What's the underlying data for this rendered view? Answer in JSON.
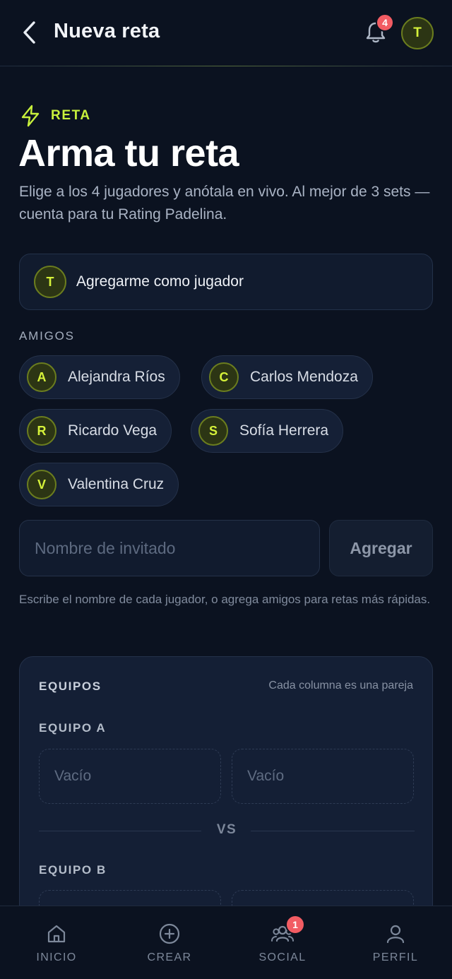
{
  "header": {
    "title": "Nueva reta",
    "notifications_count": "4",
    "avatar_initial": "T"
  },
  "hero": {
    "eyebrow": "RETA",
    "title": "Arma tu reta",
    "description": "Elige a los 4 jugadores y anótala en vivo. Al mejor de 3 sets — cuenta para tu Rating Padelina."
  },
  "add_me": {
    "avatar_initial": "T",
    "label": "Agregarme como jugador"
  },
  "friends": {
    "label": "AMIGOS",
    "items": [
      {
        "initial": "A",
        "name": "Alejandra Ríos"
      },
      {
        "initial": "C",
        "name": "Carlos Mendoza"
      },
      {
        "initial": "R",
        "name": "Ricardo Vega"
      },
      {
        "initial": "S",
        "name": "Sofía Herrera"
      },
      {
        "initial": "V",
        "name": "Valentina Cruz"
      }
    ]
  },
  "guest": {
    "placeholder": "Nombre de invitado",
    "add_label": "Agregar",
    "hint": "Escribe el nombre de cada jugador, o agrega amigos para retas más rápidas."
  },
  "teams": {
    "title": "EQUIPOS",
    "subtitle": "Cada columna es una pareja",
    "team_a": {
      "label": "EQUIPO A",
      "slots": [
        "Vacío",
        "Vacío"
      ]
    },
    "vs": "VS",
    "team_b": {
      "label": "EQUIPO B"
    }
  },
  "nav": {
    "items": [
      {
        "label": "INICIO",
        "icon": "home-icon"
      },
      {
        "label": "CREAR",
        "icon": "plus-circle-icon"
      },
      {
        "label": "SOCIAL",
        "icon": "users-icon",
        "badge": "1"
      },
      {
        "label": "PERFIL",
        "icon": "user-icon"
      }
    ]
  },
  "colors": {
    "background": "#0b1220",
    "accent": "#c8f03c",
    "badge": "#f25c63",
    "card": "#141f35"
  }
}
